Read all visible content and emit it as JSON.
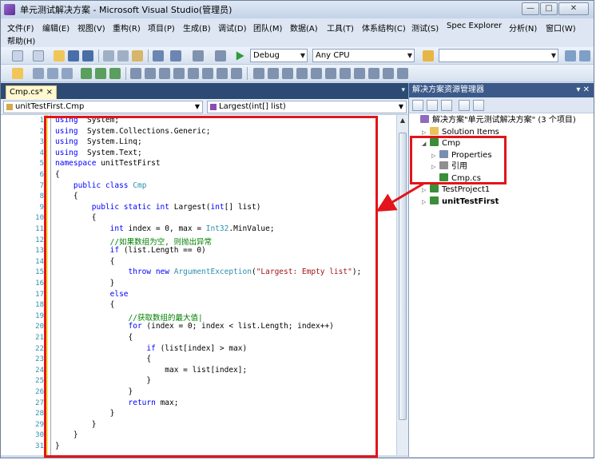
{
  "window": {
    "title": "单元测试解决方案 - Microsoft Visual Studio(管理员)",
    "controls": [
      "—",
      "□",
      "✕"
    ]
  },
  "menu": {
    "row1": [
      "文件(F)",
      "编辑(E)",
      "视图(V)",
      "重构(R)",
      "项目(P)",
      "生成(B)",
      "调试(D)",
      "团队(M)",
      "数据(A)",
      "工具(T)",
      "体系结构(C)",
      "测试(S)",
      "Spec Explorer",
      "分析(N)",
      "窗口(W)"
    ],
    "row2": [
      "帮助(H)"
    ]
  },
  "toolbar": {
    "config_value": "Debug",
    "platform_value": "Any CPU",
    "find_value": ""
  },
  "editor": {
    "tab_label": "Cmp.cs*",
    "tab_close": "×",
    "class_combo": "unitTestFirst.Cmp",
    "member_combo": "Largest(int[] list)",
    "lines": [
      [
        [
          "kw",
          "using"
        ],
        [
          "",
          "  System;"
        ]
      ],
      [
        [
          "kw",
          "using"
        ],
        [
          "",
          "  System.Collections.Generic;"
        ]
      ],
      [
        [
          "kw",
          "using"
        ],
        [
          "",
          "  System.Linq;"
        ]
      ],
      [
        [
          "kw",
          "using"
        ],
        [
          "",
          "  System.Text;"
        ]
      ],
      [
        [
          "kw",
          "namespace"
        ],
        [
          "",
          " unitTestFirst"
        ]
      ],
      [
        [
          "",
          "{"
        ]
      ],
      [
        [
          "",
          "    "
        ],
        [
          "kw",
          "public class"
        ],
        [
          "",
          " "
        ],
        [
          "ty",
          "Cmp"
        ]
      ],
      [
        [
          "",
          "    {"
        ]
      ],
      [
        [
          "",
          "        "
        ],
        [
          "kw",
          "public static int"
        ],
        [
          "",
          " Largest("
        ],
        [
          "kw",
          "int"
        ],
        [
          "",
          "[] list)"
        ]
      ],
      [
        [
          "",
          "        {"
        ]
      ],
      [
        [
          "",
          "            "
        ],
        [
          "kw",
          "int"
        ],
        [
          "",
          " index = 0, max = "
        ],
        [
          "ty",
          "Int32"
        ],
        [
          "",
          ".MinValue;"
        ]
      ],
      [
        [
          "",
          "            "
        ],
        [
          "cm",
          "//如果数组为空, 则抛出异常"
        ]
      ],
      [
        [
          "",
          "            "
        ],
        [
          "kw",
          "if"
        ],
        [
          "",
          " (list.Length == 0)"
        ]
      ],
      [
        [
          "",
          "            {"
        ]
      ],
      [
        [
          "",
          "                "
        ],
        [
          "kw",
          "throw new"
        ],
        [
          "",
          " "
        ],
        [
          "ty",
          "ArgumentException"
        ],
        [
          "",
          "("
        ],
        [
          "str",
          "\"Largest: Empty list\""
        ],
        [
          "",
          ");"
        ]
      ],
      [
        [
          "",
          "            }"
        ]
      ],
      [
        [
          "",
          "            "
        ],
        [
          "kw",
          "else"
        ]
      ],
      [
        [
          "",
          "            {"
        ]
      ],
      [
        [
          "",
          "                "
        ],
        [
          "cm",
          "//获取数组的最大值|"
        ]
      ],
      [
        [
          "",
          "                "
        ],
        [
          "kw",
          "for"
        ],
        [
          "",
          " (index = 0; index < list.Length; index++)"
        ]
      ],
      [
        [
          "",
          "                {"
        ]
      ],
      [
        [
          "",
          "                    "
        ],
        [
          "kw",
          "if"
        ],
        [
          "",
          " (list[index] > max)"
        ]
      ],
      [
        [
          "",
          "                    {"
        ]
      ],
      [
        [
          "",
          "                        max = list[index];"
        ]
      ],
      [
        [
          "",
          "                    }"
        ]
      ],
      [
        [
          "",
          "                }"
        ]
      ],
      [
        [
          "",
          "                "
        ],
        [
          "kw",
          "return"
        ],
        [
          "",
          " max;"
        ]
      ],
      [
        [
          "",
          "            }"
        ]
      ],
      [
        [
          "",
          "        }"
        ]
      ],
      [
        [
          "",
          "    }"
        ]
      ],
      [
        [
          "",
          "}"
        ]
      ]
    ]
  },
  "solution_explorer": {
    "title": "解决方案资源管理器",
    "pin": "▾ ✕",
    "tree": [
      {
        "label": "解决方案\"单元测试解决方案\" (3 个项目)",
        "level": 0,
        "expander": "",
        "icon": "solution-icon",
        "color": "#8f6bc0",
        "bold": false
      },
      {
        "label": "Solution Items",
        "level": 1,
        "expander": "▷",
        "icon": "folder-icon",
        "color": "#e8c25a",
        "bold": false
      },
      {
        "label": "Cmp",
        "level": 1,
        "expander": "◢",
        "icon": "csharp-project-icon",
        "color": "#3a8e3a",
        "bold": false
      },
      {
        "label": "Properties",
        "level": 2,
        "expander": "▷",
        "icon": "properties-icon",
        "color": "#7a8fb0",
        "bold": false
      },
      {
        "label": "引用",
        "level": 2,
        "expander": "▷",
        "icon": "references-icon",
        "color": "#8f8f8f",
        "bold": false
      },
      {
        "label": "Cmp.cs",
        "level": 2,
        "expander": "",
        "icon": "csharp-file-icon",
        "color": "#3a8e3a",
        "bold": false
      },
      {
        "label": "TestProject1",
        "level": 1,
        "expander": "▷",
        "icon": "test-project-icon",
        "color": "#3a8e3a",
        "bold": false
      },
      {
        "label": "unitTestFirst",
        "level": 1,
        "expander": "▷",
        "icon": "csharp-project-icon",
        "color": "#3a8e3a",
        "bold": true
      }
    ]
  },
  "colors": {
    "annotation": "#e3141b",
    "keyword": "#0000ff",
    "type": "#2b91af",
    "comment": "#008000",
    "string": "#a31515"
  }
}
